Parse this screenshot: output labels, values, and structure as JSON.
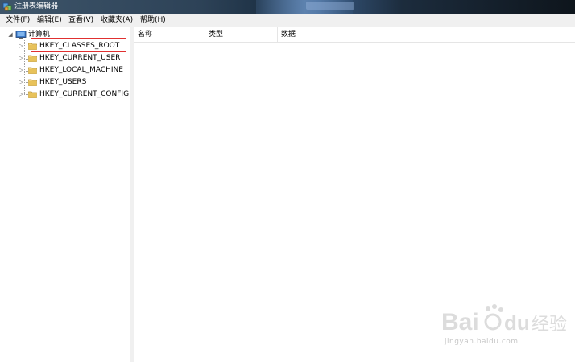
{
  "window": {
    "title": "注册表编辑器"
  },
  "menu": {
    "items": [
      "文件(F)",
      "编辑(E)",
      "查看(V)",
      "收藏夹(A)",
      "帮助(H)"
    ]
  },
  "tree": {
    "root": {
      "label": "计算机",
      "expanded": true
    },
    "children": [
      {
        "label": "HKEY_CLASSES_ROOT",
        "highlighted": true
      },
      {
        "label": "HKEY_CURRENT_USER"
      },
      {
        "label": "HKEY_LOCAL_MACHINE"
      },
      {
        "label": "HKEY_USERS"
      },
      {
        "label": "HKEY_CURRENT_CONFIG"
      }
    ]
  },
  "list": {
    "columns": [
      "名称",
      "类型",
      "数据"
    ]
  },
  "watermark": {
    "brand": "Bai经验",
    "url": "jingyan.baidu.com"
  },
  "colors": {
    "highlight_border": "#e03030",
    "folder": "#e8c25a"
  }
}
